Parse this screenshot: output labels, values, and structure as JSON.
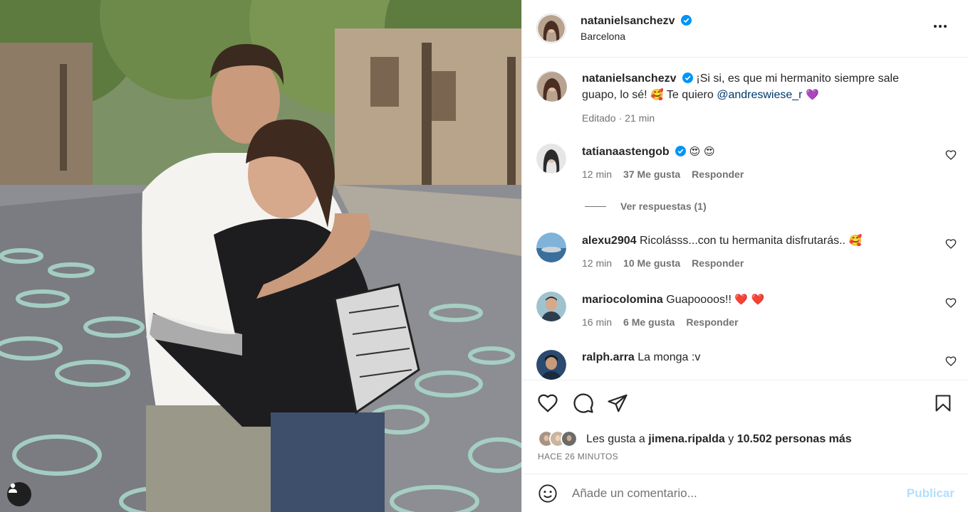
{
  "post": {
    "author": "natanielsanchezv",
    "location": "Barcelona",
    "caption_line1": "¡Si si, es que mi hermanito siempre sale",
    "caption_line2": "guapo, lo sé!",
    "caption_emoji1": "🥰",
    "caption_text2": "Te quiero",
    "caption_mention": "@andreswiese_r",
    "caption_emoji2": "💜",
    "edited_label": "Editado",
    "edited_time": "21 min"
  },
  "comments": [
    {
      "user": "tatianaastengob",
      "text": "😍 😍",
      "time": "12 min",
      "likes": "37 Me gusta",
      "reply": "Responder",
      "avatar_color": "#3b3b3b"
    },
    {
      "user": "alexu2904",
      "text": "Ricolásss...con tu hermanita disfrutarás..",
      "emoji": "🥰",
      "time": "12 min",
      "likes": "10 Me gusta",
      "reply": "Responder",
      "avatar_color": "#4a86b8"
    },
    {
      "user": "mariocolomina",
      "text": "Guapoooos!!",
      "emoji": "❤️ ❤️",
      "time": "16 min",
      "likes": "6 Me gusta",
      "reply": "Responder",
      "avatar_color": "#8aa6b0"
    },
    {
      "user": "ralph.arra",
      "text": "La monga :v",
      "avatar_color": "#1e3a5c"
    }
  ],
  "view_replies": "Ver respuestas (1)",
  "likes": {
    "prefix": "Les gusta a",
    "user": "jimena.ripalda",
    "and": "y",
    "count": "10.502 personas más"
  },
  "time_ago": "HACE 26 MINUTOS",
  "add_comment": {
    "placeholder": "Añade un comentario...",
    "publish": "Publicar"
  },
  "colors": {
    "verified": "#0095f6",
    "link": "#00376b",
    "publish_disabled": "#b2dffc"
  }
}
